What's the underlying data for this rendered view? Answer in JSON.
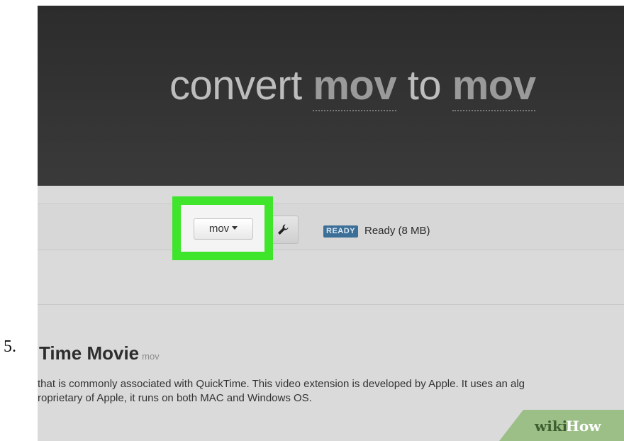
{
  "step": {
    "number": "5."
  },
  "hero": {
    "word1": "convert",
    "from_format": "mov",
    "word2": "to",
    "to_format": "mov"
  },
  "file_row": {
    "format_button": {
      "label": "mov",
      "icon": "chevron-down-icon"
    },
    "settings_button": {
      "icon": "wrench-icon"
    },
    "status_badge": {
      "label": "READY",
      "color": "#3b6f98"
    },
    "status_text": "Ready (8 MB)"
  },
  "highlight": {
    "color": "#3ee52a"
  },
  "section": {
    "title": "Time Movie",
    "extension": "mov",
    "description_lines": [
      "that is commonly associated with QuickTime. This video extension is developed by Apple. It uses an alg",
      "roprietary of Apple, it runs on both MAC and Windows OS."
    ]
  },
  "watermark": {
    "part1": "wiki",
    "part2": "How"
  }
}
